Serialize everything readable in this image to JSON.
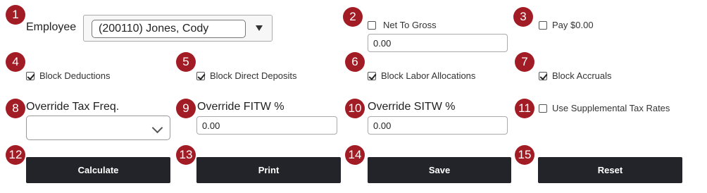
{
  "badges": [
    "1",
    "2",
    "3",
    "4",
    "5",
    "6",
    "7",
    "8",
    "9",
    "10",
    "11",
    "12",
    "13",
    "14",
    "15"
  ],
  "employee": {
    "label": "Employee",
    "value": "(200110) Jones, Cody"
  },
  "net_to_gross": {
    "label": "Net To Gross",
    "checked": false,
    "value": "0.00"
  },
  "pay_zero": {
    "label": "Pay $0.00",
    "checked": false
  },
  "block_deductions": {
    "label": "Block Deductions",
    "checked": true
  },
  "block_direct_deposits": {
    "label": "Block Direct Deposits",
    "checked": true
  },
  "block_labor_allocations": {
    "label": "Block Labor Allocations",
    "checked": true
  },
  "block_accruals": {
    "label": "Block Accruals",
    "checked": true
  },
  "override_tax_freq": {
    "label": "Override Tax Freq.",
    "value": ""
  },
  "override_fitw": {
    "label": "Override FITW %",
    "value": "0.00"
  },
  "override_sitw": {
    "label": "Override SITW %",
    "value": "0.00"
  },
  "supplemental": {
    "label": "Use Supplemental Tax Rates",
    "checked": false
  },
  "buttons": {
    "calculate": "Calculate",
    "print": "Print",
    "save": "Save",
    "reset": "Reset"
  },
  "colors": {
    "badge": "#a21c25",
    "button_bg": "#222429",
    "button_text": "#ffffff"
  },
  "icons": {
    "employee_dropdown": "triangle-down-icon",
    "tax_freq_dropdown": "chevron-down-icon",
    "checkmark": "checkmark-icon"
  }
}
